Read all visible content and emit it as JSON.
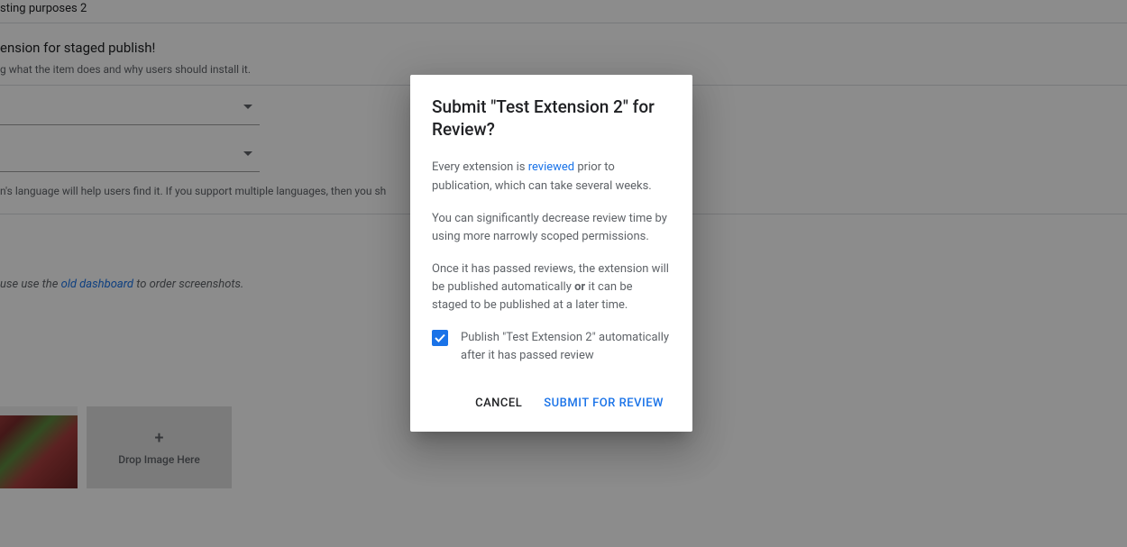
{
  "background": {
    "field1": "sting purposes 2",
    "heading1": "ension for staged publish!",
    "hint1": "g what the item does and why users should install it.",
    "lang_hint": "n's language will help users find it. If you support multiple languages, then you sh",
    "screenshots_hint_pre": "use use the ",
    "screenshots_link": "old dashboard",
    "screenshots_hint_post": " to order screenshots.",
    "drop_label": "Drop Image Here"
  },
  "dialog": {
    "title": "Submit \"Test Extension 2\" for Review?",
    "p1_pre": "Every extension is ",
    "p1_link": "reviewed",
    "p1_post": " prior to publication, which can take several weeks.",
    "p2": "You can significantly decrease review time by using more narrowly scoped permissions.",
    "p3_pre": "Once it has passed reviews, the extension will be published automatically ",
    "p3_bold": "or",
    "p3_post": " it can be staged to be published at a later time.",
    "checkbox_label": "Publish \"Test Extension 2\" automatically after it has passed review",
    "cancel": "CANCEL",
    "submit": "SUBMIT FOR REVIEW"
  }
}
